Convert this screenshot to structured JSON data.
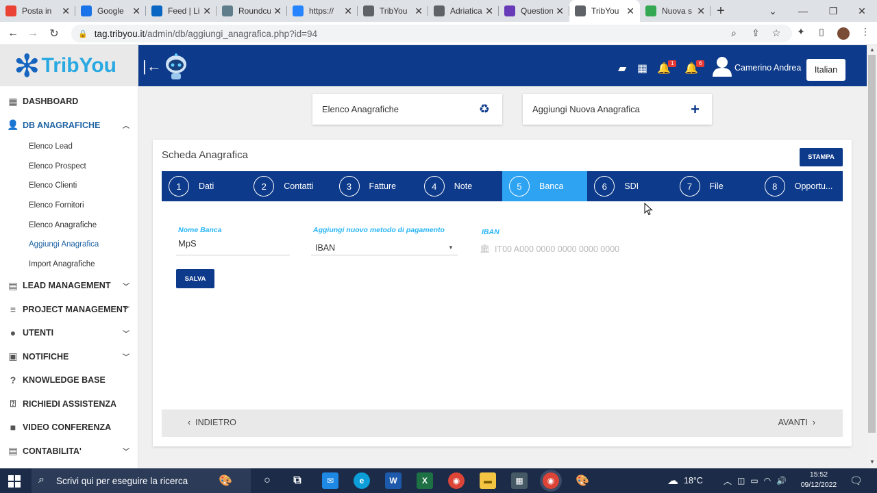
{
  "browser": {
    "tabs": [
      {
        "title": "Posta in",
        "icon": "gmail-icon",
        "color": "#ea4335"
      },
      {
        "title": "Google",
        "icon": "google-drive-icon",
        "color": "#1a73e8"
      },
      {
        "title": "Feed | Li",
        "icon": "linkedin-icon",
        "color": "#0a66c2"
      },
      {
        "title": "Roundcu",
        "icon": "roundcube-icon",
        "color": "#607d8b"
      },
      {
        "title": "https://",
        "icon": "jira-icon",
        "color": "#2684ff"
      },
      {
        "title": "TribYou",
        "icon": "globe-icon",
        "color": "#5f6368"
      },
      {
        "title": "Adriatica",
        "icon": "globe-icon",
        "color": "#5f6368"
      },
      {
        "title": "Question",
        "icon": "forms-icon",
        "color": "#673ab7"
      },
      {
        "title": "TribYou",
        "icon": "globe-icon",
        "color": "#5f6368",
        "active": true
      },
      {
        "title": "Nuova s",
        "icon": "chrome-icon",
        "color": "#34a853"
      }
    ],
    "url_host": "tag.tribyou.it",
    "url_path": "/admin/db/aggiungi_anagrafica.php?id=94"
  },
  "app": {
    "logo_text": "TribYou",
    "user_name": "Camerino Andrea",
    "language": "Italian",
    "notif_badge_1": "1",
    "notif_badge_2": "6"
  },
  "sidebar": {
    "dashboard": "DASHBOARD",
    "db_anagrafiche": "DB ANAGRAFICHE",
    "sub_items": [
      "Elenco Lead",
      "Elenco Prospect",
      "Elenco Clienti",
      "Elenco Fornitori",
      "Elenco Anagrafiche",
      "Aggiungi Anagrafica",
      "Import Anagrafiche"
    ],
    "lead_management": "LEAD MANAGEMENT",
    "project_management": "PROJECT MANAGEMENT",
    "utenti": "UTENTI",
    "notifiche": "NOTIFICHE",
    "knowledge_base": "KNOWLEDGE BASE",
    "richiedi_assistenza": "RICHIEDI ASSISTENZA",
    "video_conferenza": "VIDEO CONFERENZA",
    "contabilita": "CONTABILITA'"
  },
  "main": {
    "card_elenco": "Elenco Anagrafiche",
    "card_aggiungi": "Aggiungi Nuova Anagrafica",
    "panel_title": "Scheda Anagrafica",
    "stampa": "STAMPA",
    "steps": [
      {
        "num": "1",
        "label": "Dati"
      },
      {
        "num": "2",
        "label": "Contatti"
      },
      {
        "num": "3",
        "label": "Fatture"
      },
      {
        "num": "4",
        "label": "Note"
      },
      {
        "num": "5",
        "label": "Banca",
        "active": true
      },
      {
        "num": "6",
        "label": "SDI"
      },
      {
        "num": "7",
        "label": "File"
      },
      {
        "num": "8",
        "label": "Opportu..."
      }
    ],
    "nome_banca_label": "Nome Banca",
    "nome_banca_value": "MpS",
    "metodo_label": "Aggiungi nuovo metodo di pagamento",
    "metodo_value": "IBAN",
    "iban_label": "IBAN",
    "iban_placeholder": "IT00 A000 0000 0000 0000 0000",
    "salva": "SALVA",
    "indietro": "INDIETRO",
    "avanti": "AVANTI"
  },
  "taskbar": {
    "search_placeholder": "Scrivi qui per eseguire la ricerca",
    "weather": "18°C",
    "time": "15:52",
    "date": "09/12/2022"
  }
}
